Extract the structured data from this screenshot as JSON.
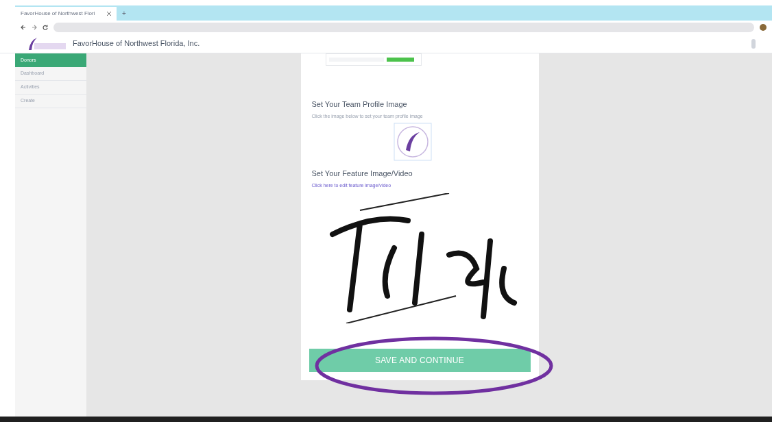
{
  "browser": {
    "tab_title": "FavorHouse of Northwest Flori",
    "new_tab": "+"
  },
  "header": {
    "org_name": "FavorHouse of Northwest Florida, Inc."
  },
  "sidebar": {
    "items": [
      {
        "label": "Donors",
        "selected": true
      },
      {
        "label": "Dashboard",
        "selected": false
      },
      {
        "label": "Activities",
        "selected": false
      },
      {
        "label": "Create",
        "selected": false
      }
    ]
  },
  "form": {
    "profile_title": "Set Your Team Profile Image",
    "profile_hint": "Click the image below to set your team profile image",
    "feature_title": "Set Your Feature Image/Video",
    "feature_link": "Click here to edit feature image/video",
    "submit": {
      "label": "SAVE AND CONTINUE",
      "highlighted": true
    }
  }
}
